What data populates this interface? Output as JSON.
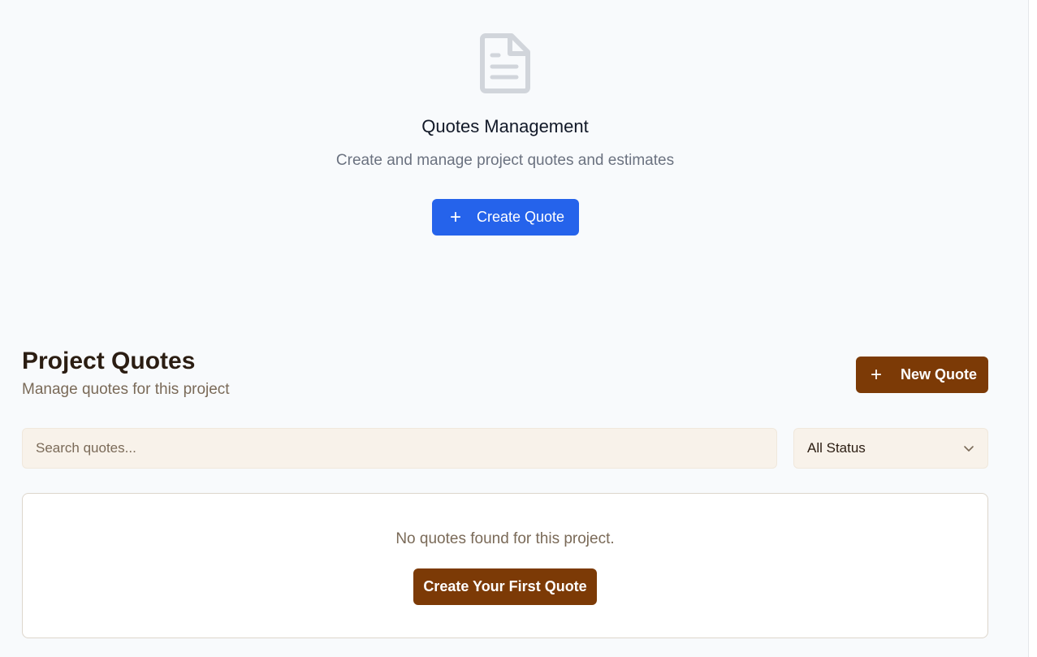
{
  "hero": {
    "icon": "document-icon",
    "title": "Quotes Management",
    "subtitle": "Create and manage project quotes and estimates",
    "create_button": {
      "icon": "plus-icon",
      "label": "Create Quote"
    }
  },
  "project_quotes": {
    "title": "Project Quotes",
    "subtitle": "Manage quotes for this project",
    "new_button": {
      "icon": "plus-icon",
      "label": "New Quote"
    },
    "search": {
      "placeholder": "Search quotes...",
      "value": ""
    },
    "status_filter": {
      "selected": "All Status",
      "icon": "chevron-down-icon"
    },
    "empty_state": {
      "message": "No quotes found for this project.",
      "button_label": "Create Your First Quote"
    }
  },
  "colors": {
    "primary_blue": "#2563eb",
    "brand_brown": "#7c3a06",
    "background": "#f8fafc",
    "input_bg": "#f8f2ea"
  }
}
